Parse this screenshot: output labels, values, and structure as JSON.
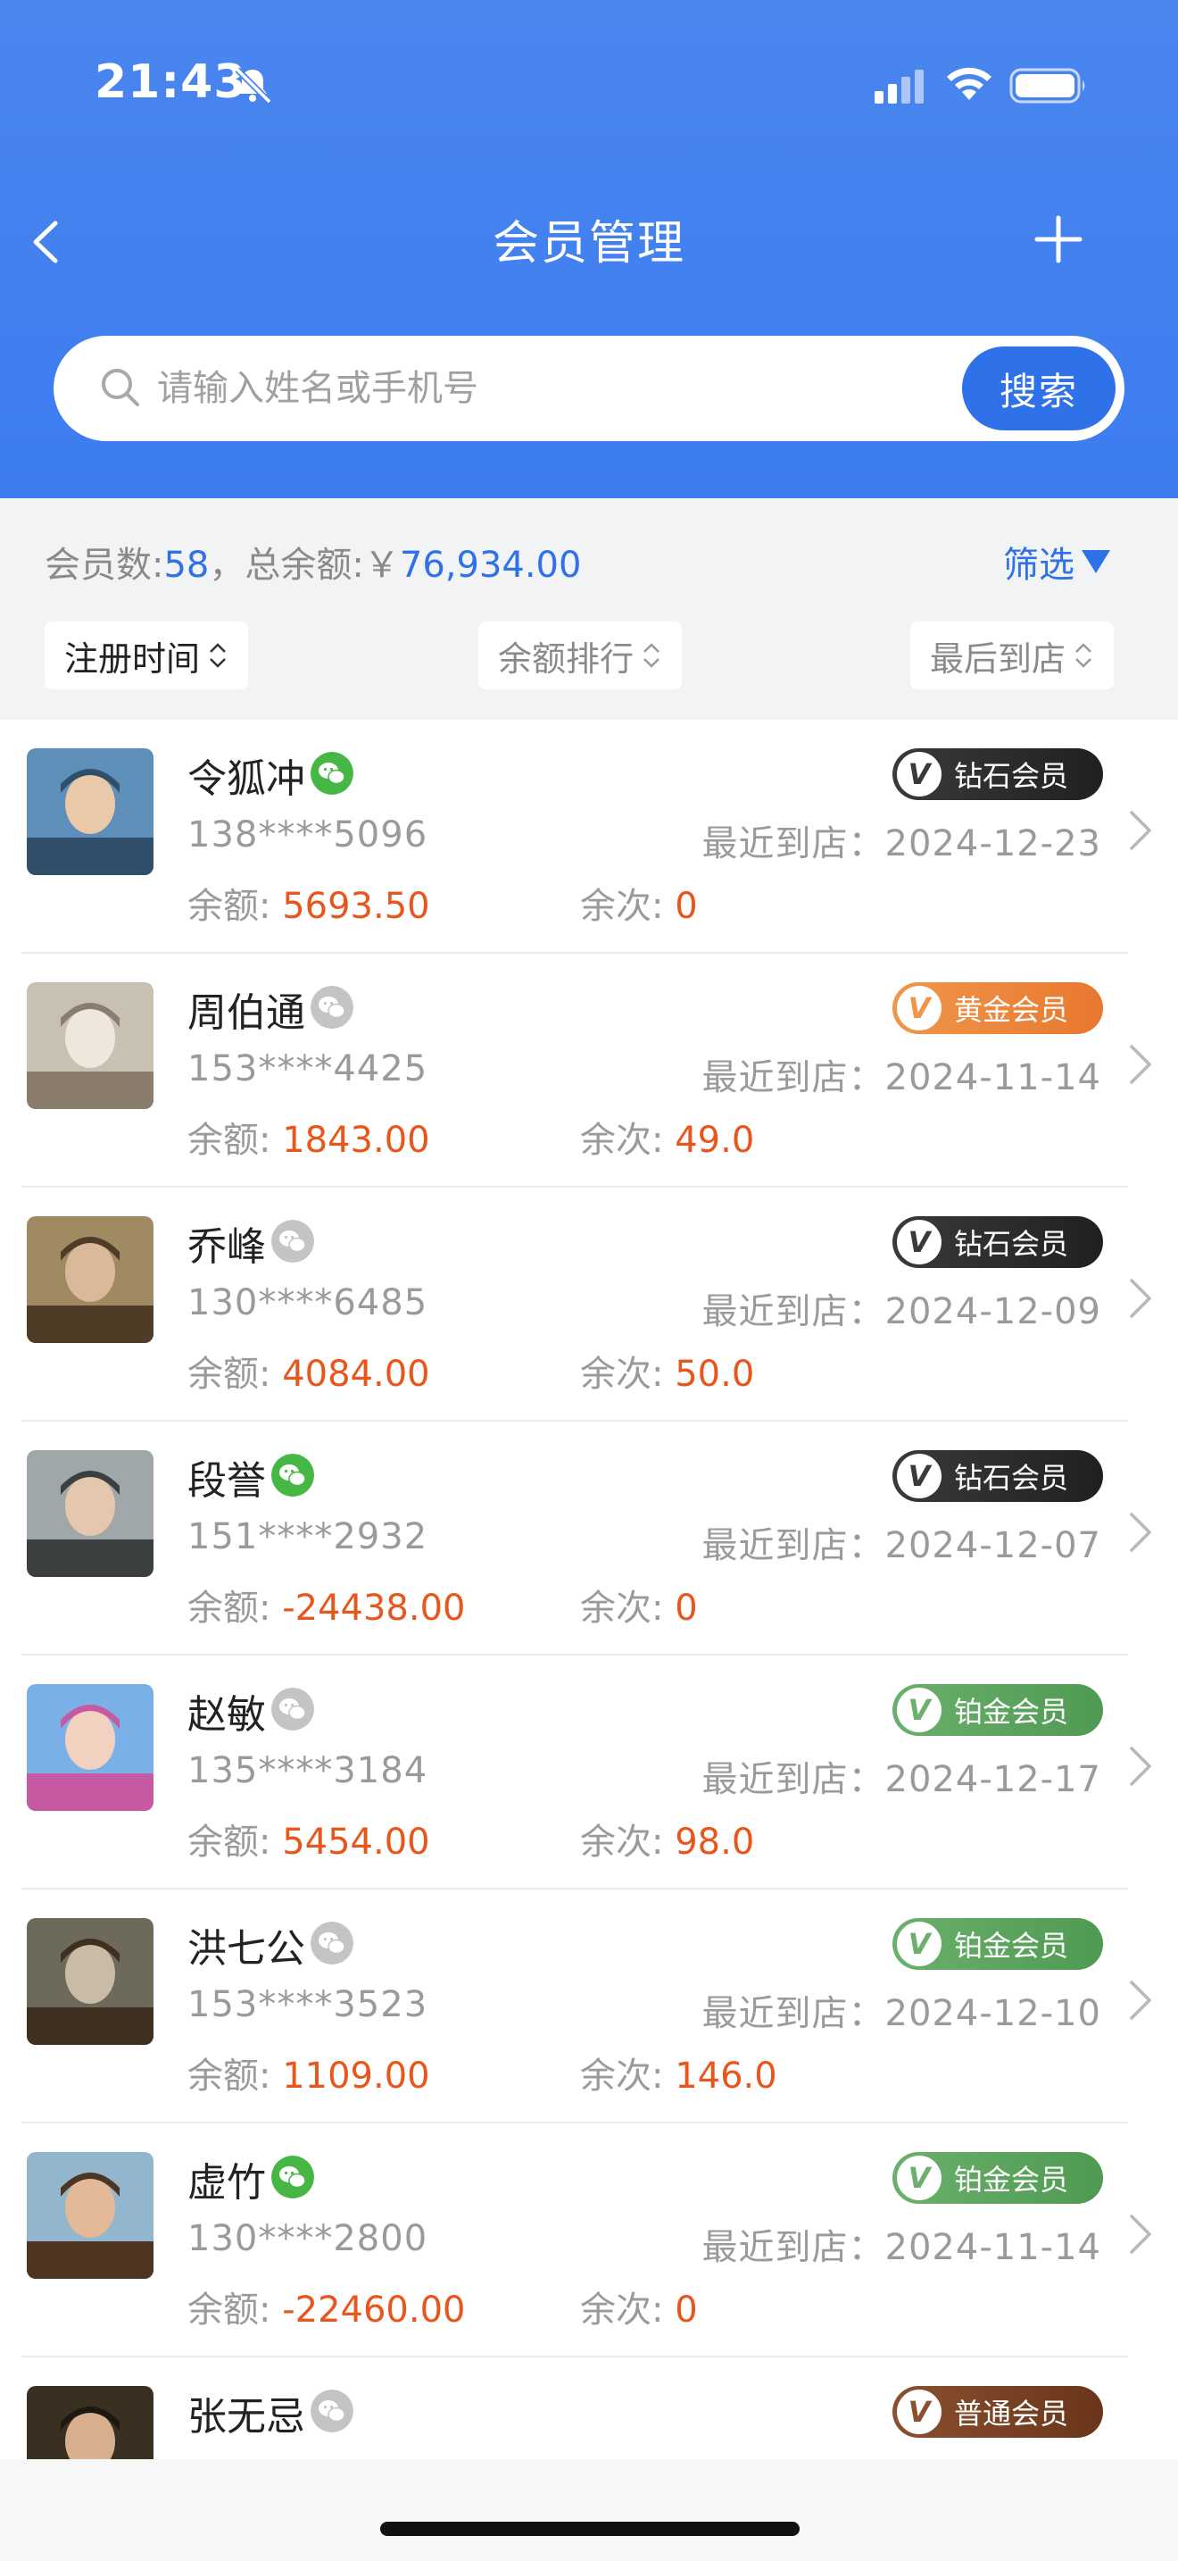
{
  "status_bar": {
    "time": "21:43"
  },
  "header": {
    "title": "会员管理"
  },
  "search": {
    "placeholder": "请输入姓名或手机号",
    "button_label": "搜索"
  },
  "summary": {
    "members_label": "会员数:",
    "members_count": "58",
    "separator": "，",
    "total_label": "总余额:",
    "currency": "￥",
    "total_balance": "76,934.00",
    "filter_label": "筛选"
  },
  "sorts": [
    {
      "label": "注册时间"
    },
    {
      "label": "余额排行"
    },
    {
      "label": "最后到店"
    }
  ],
  "labels": {
    "last_visit": "最近到店：",
    "balance": "余额: ",
    "count": "余次: "
  },
  "members": [
    {
      "name": "令狐冲",
      "wechat_bound": true,
      "phone": "138****5096",
      "last_visit": "2024-12-23",
      "balance": "5693.50",
      "count": "0",
      "level": "钻石会员",
      "level_color": "diamond"
    },
    {
      "name": "周伯通",
      "wechat_bound": false,
      "phone": "153****4425",
      "last_visit": "2024-11-14",
      "balance": "1843.00",
      "count": "49.0",
      "level": "黄金会员",
      "level_color": "gold"
    },
    {
      "name": "乔峰",
      "wechat_bound": false,
      "phone": "130****6485",
      "last_visit": "2024-12-09",
      "balance": "4084.00",
      "count": "50.0",
      "level": "钻石会员",
      "level_color": "diamond"
    },
    {
      "name": "段誉",
      "wechat_bound": true,
      "phone": "151****2932",
      "last_visit": "2024-12-07",
      "balance": "-24438.00",
      "count": "0",
      "level": "钻石会员",
      "level_color": "diamond"
    },
    {
      "name": "赵敏",
      "wechat_bound": false,
      "phone": "135****3184",
      "last_visit": "2024-12-17",
      "balance": "5454.00",
      "count": "98.0",
      "level": "铂金会员",
      "level_color": "platinum"
    },
    {
      "name": "洪七公",
      "wechat_bound": false,
      "phone": "153****3523",
      "last_visit": "2024-12-10",
      "balance": "1109.00",
      "count": "146.0",
      "level": "铂金会员",
      "level_color": "platinum"
    },
    {
      "name": "虚竹",
      "wechat_bound": true,
      "phone": "130****2800",
      "last_visit": "2024-11-14",
      "balance": "-22460.00",
      "count": "0",
      "level": "铂金会员",
      "level_color": "platinum"
    },
    {
      "name": "张无忌",
      "wechat_bound": false,
      "phone": "",
      "last_visit": "",
      "balance": "",
      "count": "",
      "level": "普通会员",
      "level_color": "normal"
    }
  ],
  "colors": {
    "accent": "#2f71e8",
    "warning_text": "#e8561b",
    "diamond": "#3a3a3a",
    "gold": "#f0964a",
    "platinum": "#6bb06c",
    "normal": "#8a5030",
    "wechat_bound": "#46b744",
    "wechat_unbound": "#c4c4c4"
  },
  "icons": [
    "bell-slash-icon",
    "cellular-signal-icon",
    "wifi-icon",
    "battery-icon",
    "back-arrow-icon",
    "plus-icon",
    "search-icon",
    "wechat-icon",
    "vip-v-icon",
    "chevron-right-icon",
    "sort-arrows-icon",
    "triangle-down-icon"
  ]
}
